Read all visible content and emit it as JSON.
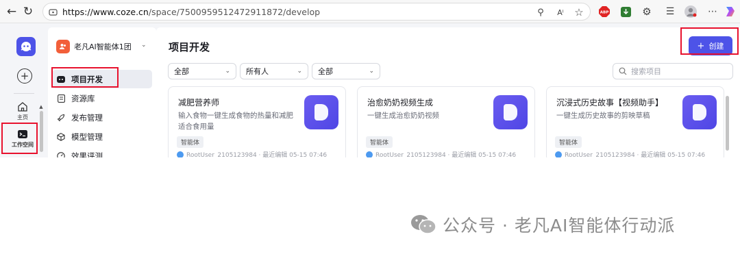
{
  "browser": {
    "url_host": "https://www.coze.cn",
    "url_path": "/space/7500959512472911872/develop"
  },
  "rail": {
    "home_label": "主页",
    "workspace_label": "工作空间"
  },
  "sidebar": {
    "team_name": "老凡AI智能体1团",
    "items": [
      {
        "label": "项目开发",
        "icon": "robot-icon",
        "active": true
      },
      {
        "label": "资源库",
        "icon": "library-icon",
        "active": false
      },
      {
        "label": "发布管理",
        "icon": "rocket-icon",
        "active": false
      },
      {
        "label": "模型管理",
        "icon": "cube-icon",
        "active": false
      },
      {
        "label": "效果评测",
        "icon": "gauge-icon",
        "active": false
      }
    ]
  },
  "main": {
    "title": "项目开发",
    "create_label": "创建",
    "filters": [
      "全部",
      "所有人",
      "全部"
    ],
    "search_placeholder": "搜索项目",
    "cards": [
      {
        "title": "减肥营养师",
        "desc": "输入食物一键生成食物的热量和减肥适合食用量",
        "tag": "智能体",
        "meta": "RootUser_2105123984 · 最近编辑 05-15 07:46"
      },
      {
        "title": "治愈奶奶视频生成",
        "desc": "一键生成治愈奶奶视频",
        "tag": "智能体",
        "meta": "RootUser_2105123984 · 最近编辑 05-15 07:46"
      },
      {
        "title": "沉浸式历史故事【视频助手】",
        "desc": "一键生成历史故事的剪映草稿",
        "tag": "智能体",
        "meta": "RootUser_2105123984 · 最近编辑 05-15 07:46"
      }
    ]
  },
  "watermark": {
    "text": "公众号 · 老凡AI智能体行动派"
  },
  "colors": {
    "accent": "#4d53e8",
    "highlight": "#e8112d"
  }
}
